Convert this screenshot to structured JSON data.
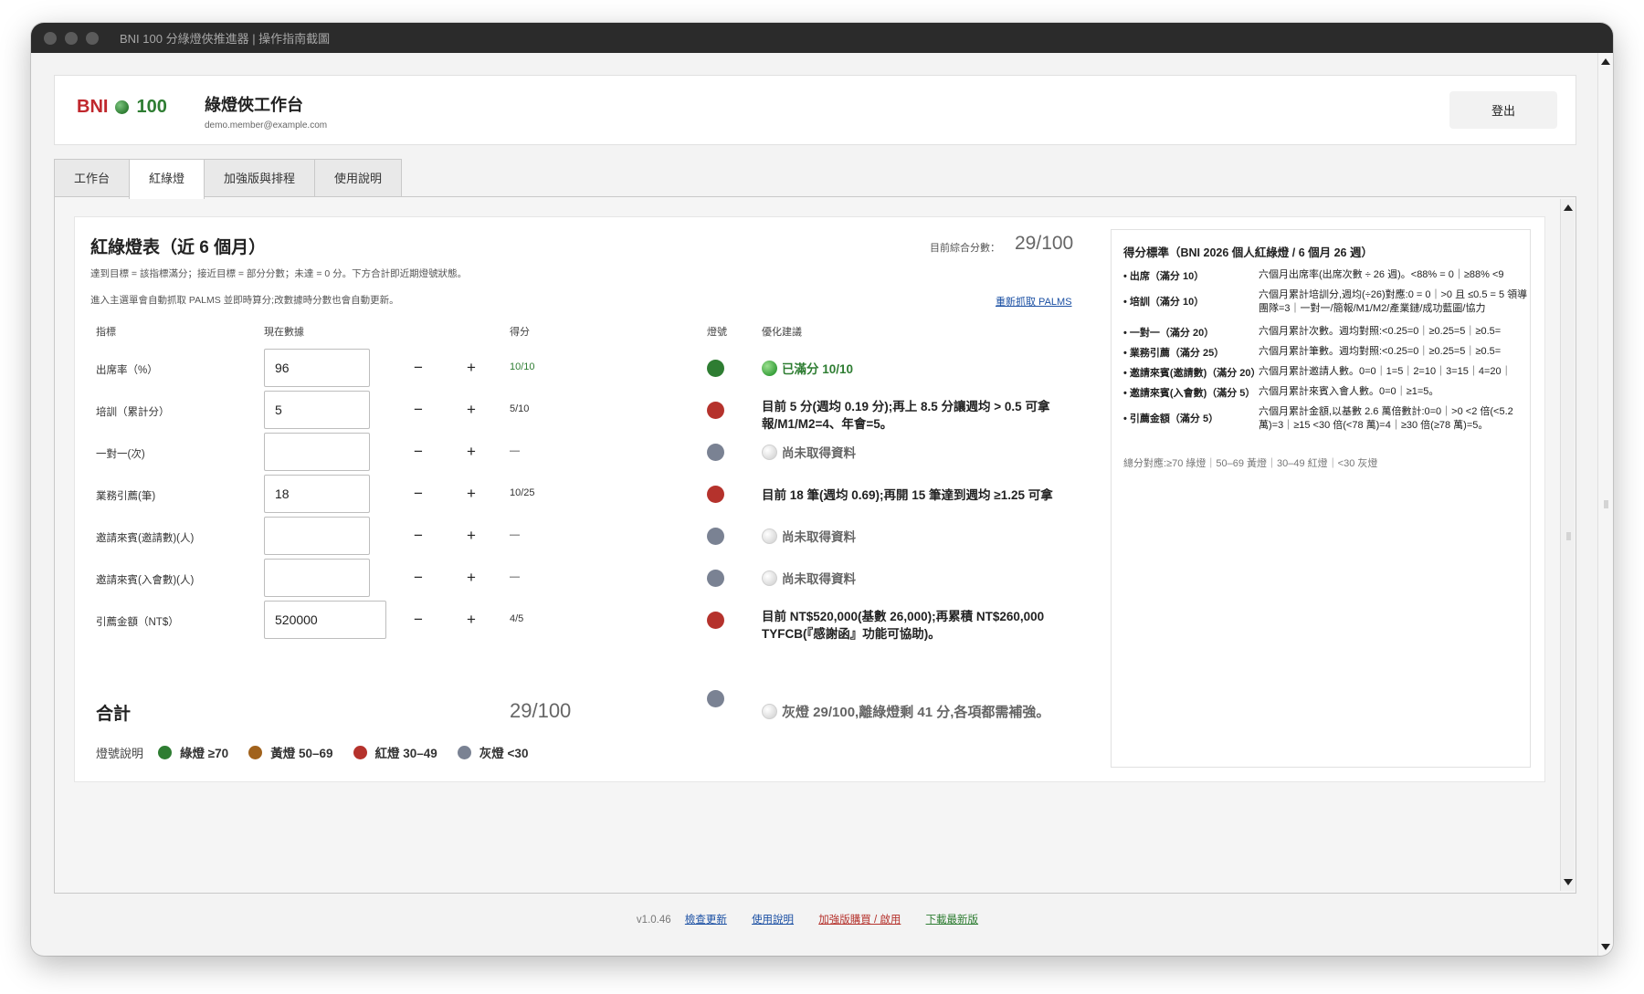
{
  "window": {
    "title": "BNI 100 分綠燈俠推進器 | 操作指南截圖"
  },
  "header": {
    "brand_bni": "BNI",
    "brand_score": "100",
    "title": "綠燈俠工作台",
    "email": "demo.member@example.com",
    "logout_label": "登出"
  },
  "tabs": [
    {
      "label": "工作台",
      "active": false
    },
    {
      "label": "紅綠燈",
      "active": true
    },
    {
      "label": "加強版與排程",
      "active": false
    },
    {
      "label": "使用說明",
      "active": false
    }
  ],
  "panel": {
    "title": "紅綠燈表（近 6 個月）",
    "desc": "達到目標 = 該指標滿分；接近目標 = 部分分數；未達 = 0 分。下方合計即近期燈號狀態。",
    "note": "進入主選單會自動抓取 PALMS 並即時算分;改數據時分數也會自動更新。",
    "score_label": "目前綜合分數：",
    "score_value": "29/100",
    "refetch_label": "重新抓取 PALMS",
    "columns": {
      "metric": "指標",
      "data": "現在數據",
      "score": "得分",
      "light": "燈號",
      "tip": "優化建議"
    },
    "stepper": {
      "minus": "−",
      "plus": "+"
    },
    "rows": [
      {
        "label": "出席率（%）",
        "value": "96",
        "score": "10/10",
        "light": "green",
        "tip": "已滿分 10/10"
      },
      {
        "label": "培訓（累計分）",
        "value": "5",
        "score": "5/10",
        "light": "red",
        "tip": "目前 5 分(週均 0.19 分);再上 8.5 分讓週均 > 0.5 可拿報/M1/M2=4、年會=5。"
      },
      {
        "label": "一對一(次)",
        "value": "",
        "score": "—",
        "light": "gray",
        "tip": "尚未取得資料"
      },
      {
        "label": "業務引薦(筆)",
        "value": "18",
        "score": "10/25",
        "light": "red",
        "tip": "目前 18 筆(週均 0.69);再開 15 筆達到週均 ≥1.25 可拿"
      },
      {
        "label": "邀請來賓(邀請數)(人)",
        "value": "",
        "score": "—",
        "light": "gray",
        "tip": "尚未取得資料"
      },
      {
        "label": "邀請來賓(入會數)(人)",
        "value": "",
        "score": "—",
        "light": "gray",
        "tip": "尚未取得資料"
      },
      {
        "label": "引薦金額（NT$）",
        "value": "520000",
        "score": "4/5",
        "light": "red",
        "tip": "目前 NT$520,000(基數 26,000);再累積 NT$260,000 TYFCB(『感謝函』功能可協助)。"
      }
    ],
    "total": {
      "label": "合計",
      "value": "29/100",
      "light": "gray",
      "tip": "灰燈 29/100,離綠燈剩 41 分,各項都需補強。"
    },
    "legend": {
      "title": "燈號說明",
      "items": [
        {
          "label": "綠燈 ≥70",
          "color": "#2e7d32"
        },
        {
          "label": "黃燈 50–69",
          "color": "#a1621c"
        },
        {
          "label": "紅燈 30–49",
          "color": "#b5322c"
        },
        {
          "label": "灰燈 <30",
          "color": "#7a8293"
        }
      ]
    }
  },
  "standards": {
    "title": "得分標準（BNI 2026 個人紅綠燈 / 6 個月 26 週）",
    "items": [
      {
        "key": "• 出席（滿分 10）",
        "val": "六個月出席率(出席次數 ÷ 26 週)。<88% = 0｜≥88% <9"
      },
      {
        "key": "• 培訓（滿分 10）",
        "val": "六個月累計培訓分,週均(÷26)對應:0 = 0｜>0 且 ≤0.5 = 5 領導團隊=3｜一對一/簡報/M1/M2/產業鏈/成功藍圖/協力"
      },
      {
        "key": "• 一對一（滿分 20）",
        "val": "六個月累計次數。週均對照:<0.25=0｜≥0.25=5｜≥0.5="
      },
      {
        "key": "• 業務引薦（滿分 25）",
        "val": "六個月累計筆數。週均對照:<0.25=0｜≥0.25=5｜≥0.5="
      },
      {
        "key": "• 邀請來賓(邀請數)（滿分 20）",
        "val": "六個月累計邀請人數。0=0｜1=5｜2=10｜3=15｜4=20｜"
      },
      {
        "key": "• 邀請來賓(入會數)（滿分 5）",
        "val": "六個月累計來賓入會人數。0=0｜≥1=5。"
      },
      {
        "key": "• 引薦金額（滿分 5）",
        "val": "六個月累計金額,以基數 2.6 萬倍數計:0=0｜>0 <2 倍(<5.2 萬)=3｜≥15 <30 倍(<78 萬)=4｜≥30 倍(≥78 萬)=5。"
      }
    ],
    "summary": "總分對應:≥70 綠燈｜50–69 黃燈｜30–49 紅燈｜<30 灰燈"
  },
  "footer": {
    "version": "v1.0.46",
    "links": [
      {
        "label": "檢查更新",
        "color": "#1a4fa3"
      },
      {
        "label": "使用說明",
        "color": "#1a4fa3"
      },
      {
        "label": "加強版購買 / 啟用",
        "color": "#b5322c"
      },
      {
        "label": "下載最新版",
        "color": "#2e7d32"
      }
    ]
  }
}
